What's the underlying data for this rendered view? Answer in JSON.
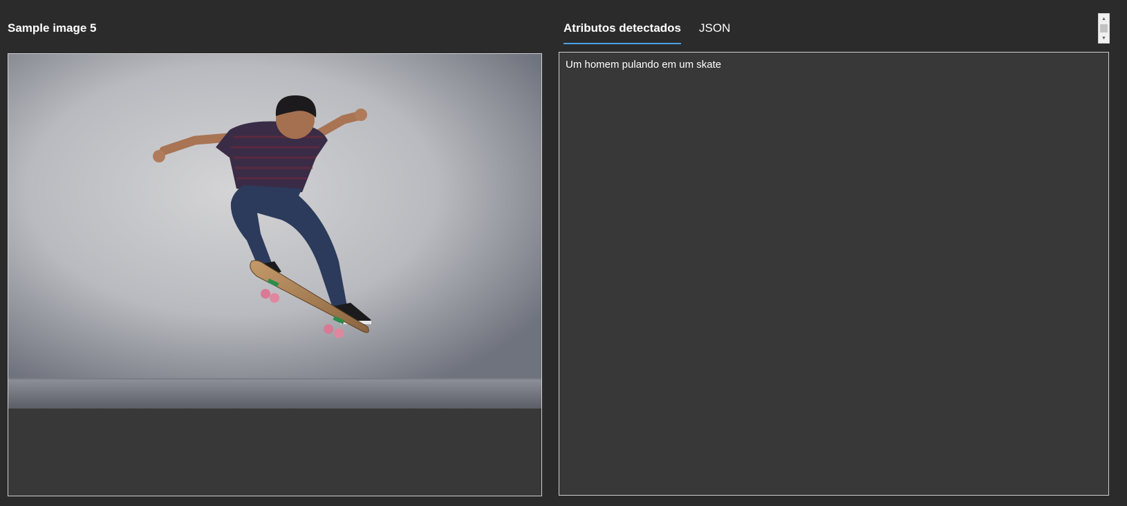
{
  "left_panel": {
    "title": "Sample image 5"
  },
  "tabs": [
    {
      "label": "Atributos detectados",
      "active": true
    },
    {
      "label": "JSON",
      "active": false
    }
  ],
  "result": {
    "caption": "Um homem pulando em um skate"
  },
  "colors": {
    "background": "#2b2b2b",
    "panel": "#383838",
    "accent": "#4aa3e8"
  }
}
